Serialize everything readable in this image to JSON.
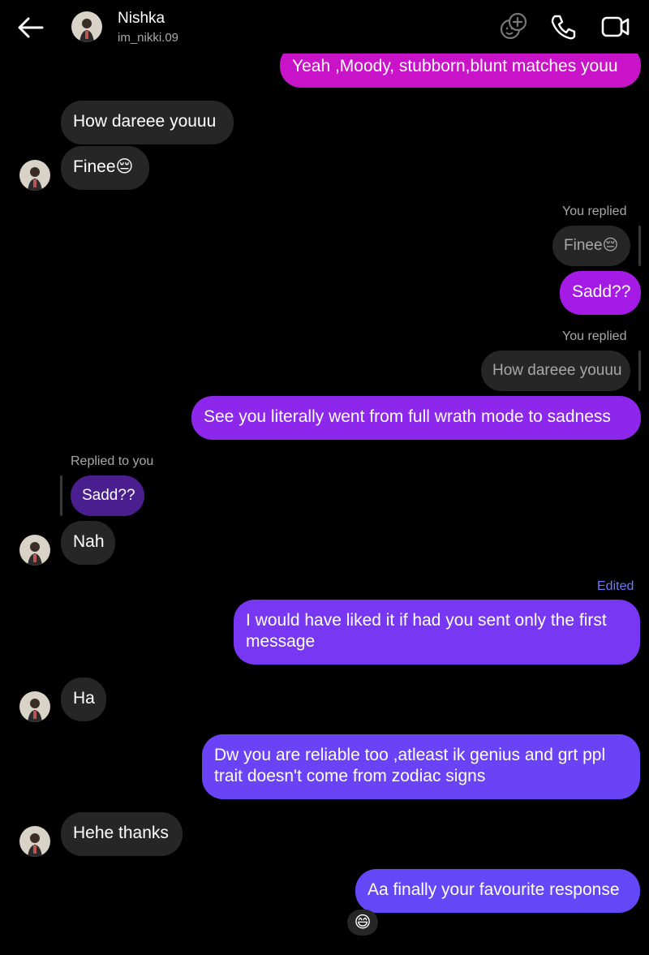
{
  "header": {
    "name": "Nishka",
    "handle": "im_nikki.09"
  },
  "colors": {
    "incoming": "#262626",
    "outgoing_magenta": "#c913c9",
    "outgoing_violet": "#9b1fe4",
    "outgoing_purple": "#8631ee",
    "outgoing_indigo": "#6e41f7",
    "outgoing_blue": "#6447f6",
    "edited_label": "#6d78ff"
  },
  "messages": {
    "m1": "Yeah ,Moody, stubborn,blunt matches youu",
    "m2": "How dareee youuu",
    "m3": "Finee😔",
    "m4_label": "You replied",
    "m4_quote": "Finee😔",
    "m4": "Sadd??",
    "m5_label": "You replied",
    "m5_quote": "How dareee youuu",
    "m5": "See you literally went from full wrath mode to sadness",
    "m6_label": "Replied to you",
    "m6_quote": "Sadd??",
    "m6": "Nah",
    "m7_edited": "Edited",
    "m7": "I would have liked it if had you sent only the first message",
    "m8": "Ha",
    "m9": "Dw you are reliable too ,atleast ik genius and grt ppl trait doesn't come from zodiac signs",
    "m10": "Hehe thanks",
    "m11": "Aa finally your favourite response",
    "m11_reaction": "😄"
  }
}
